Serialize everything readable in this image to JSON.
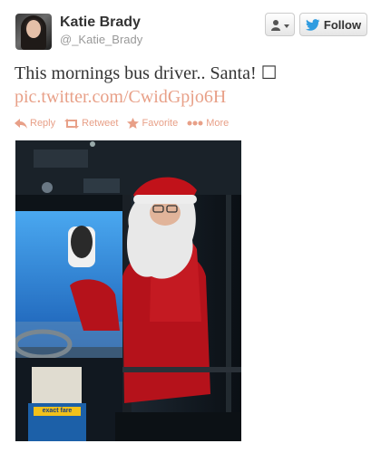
{
  "user": {
    "full_name": "Katie Brady",
    "screen_name": "@_Katie_Brady"
  },
  "buttons": {
    "follow_label": "Follow"
  },
  "tweet": {
    "text": "This mornings bus driver.. Santa! ☐",
    "link": "pic.twitter.com/CwidGpjo6H"
  },
  "actions": {
    "reply": "Reply",
    "retweet": "Retweet",
    "favorite": "Favorite",
    "more": "More"
  },
  "photo": {
    "sign_text": "exact fare"
  },
  "colors": {
    "link": "#e8a088",
    "follow_bird": "#2f9ce0"
  }
}
